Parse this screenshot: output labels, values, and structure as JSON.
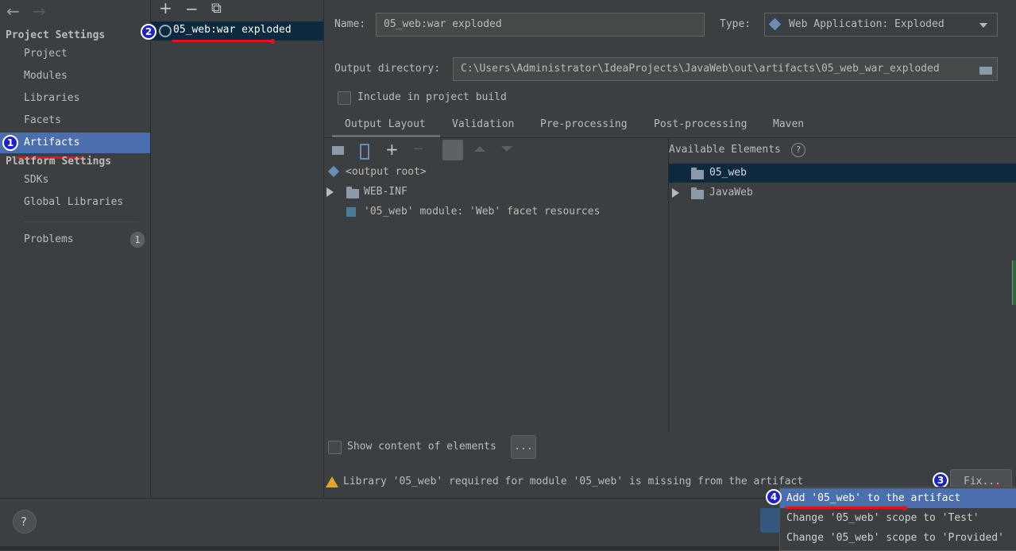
{
  "toolbar": {
    "back": "←",
    "forward": "→",
    "add": "+",
    "remove": "−",
    "copy": "⧉"
  },
  "left": {
    "project_settings": "Project Settings",
    "project_items": [
      "Project",
      "Modules",
      "Libraries",
      "Facets",
      "Artifacts"
    ],
    "platform_settings": "Platform Settings",
    "platform_items": [
      "SDKs",
      "Global Libraries"
    ],
    "problems": "Problems",
    "problems_count": "1"
  },
  "artifacts": {
    "items": [
      "05_web:war exploded"
    ]
  },
  "form": {
    "name_label": "Name:",
    "name_value": "05_web:war exploded",
    "type_label": "Type:",
    "type_value": "Web Application: Exploded",
    "output_label": "Output directory:",
    "output_value": "C:\\Users\\Administrator\\IdeaProjects\\JavaWeb\\out\\artifacts\\05_web_war_exploded",
    "include_label": "Include in project build"
  },
  "tabs": [
    "Output Layout",
    "Validation",
    "Pre-processing",
    "Post-processing",
    "Maven"
  ],
  "layout_tree": {
    "root": "<output root>",
    "webinf": "WEB-INF",
    "facet": "'05_web' module: 'Web' facet resources"
  },
  "available": {
    "title": "Available Elements",
    "help": "?",
    "items": [
      "05_web",
      "JavaWeb"
    ]
  },
  "show_content": {
    "label": "Show content of elements",
    "more": "..."
  },
  "warning": {
    "text": "Library '05_web' required for module '05_web' is missing from the artifact",
    "fix": "Fix..."
  },
  "popup": {
    "items": [
      "Add '05_web' to the artifact",
      "Change '05_web' scope to 'Test'",
      "Change '05_web' scope to 'Provided'"
    ]
  },
  "badges": [
    "1",
    "2",
    "3",
    "4"
  ],
  "bottom": {
    "help": "?"
  },
  "colors": {
    "selection": "#4b6eaf",
    "background": "#3c3f41",
    "badge": "#1e22c6",
    "annotation": "#e0151c"
  }
}
